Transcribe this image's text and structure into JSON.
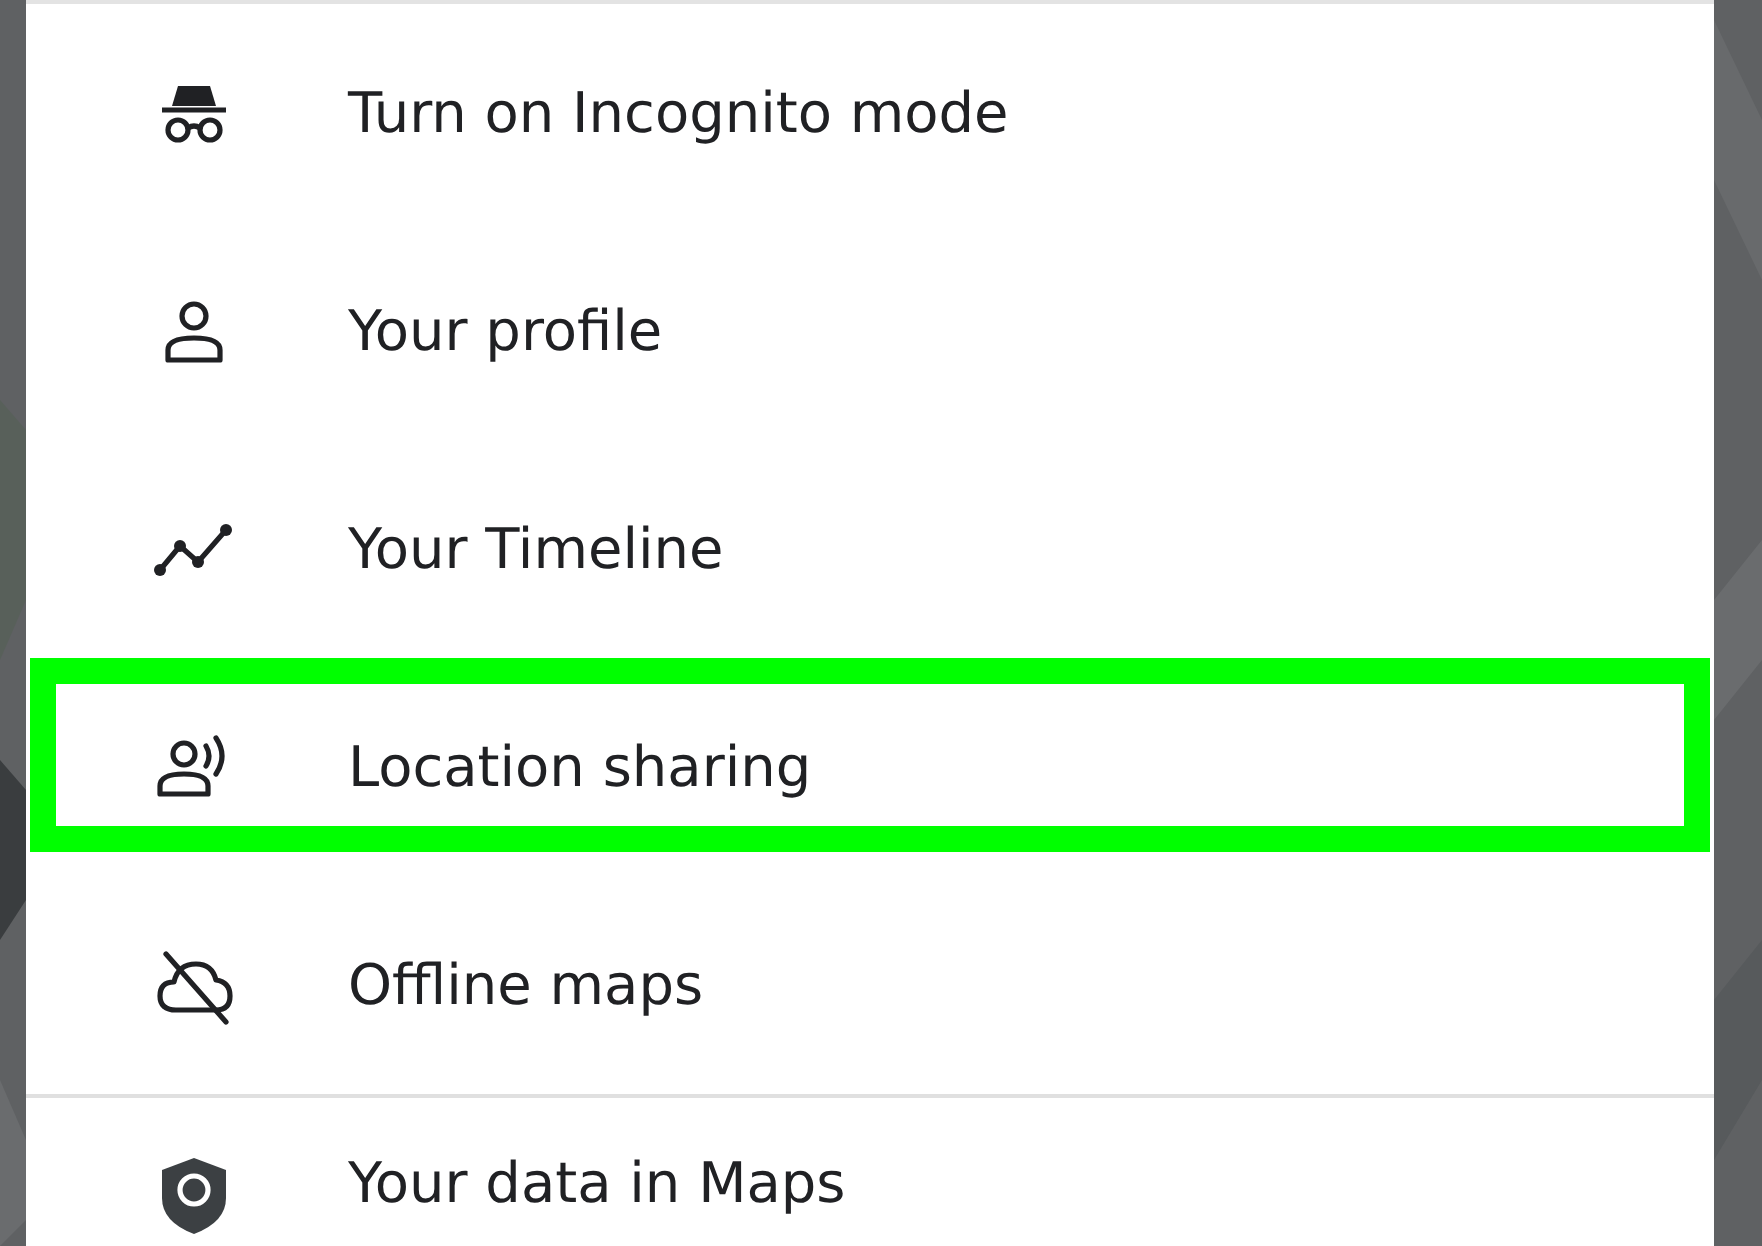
{
  "menu": {
    "sections": [
      {
        "items": [
          {
            "kind": "incognito",
            "label": "Turn on Incognito mode",
            "highlighted": false
          },
          {
            "kind": "profile",
            "label": "Your profile",
            "highlighted": false
          },
          {
            "kind": "timeline",
            "label": "Your Timeline",
            "highlighted": false
          },
          {
            "kind": "sharing",
            "label": "Location sharing",
            "highlighted": true
          },
          {
            "kind": "offline",
            "label": "Offline maps",
            "highlighted": false
          }
        ]
      },
      {
        "items": [
          {
            "kind": "data",
            "label": "Your data in Maps",
            "highlighted": false
          }
        ]
      }
    ]
  }
}
